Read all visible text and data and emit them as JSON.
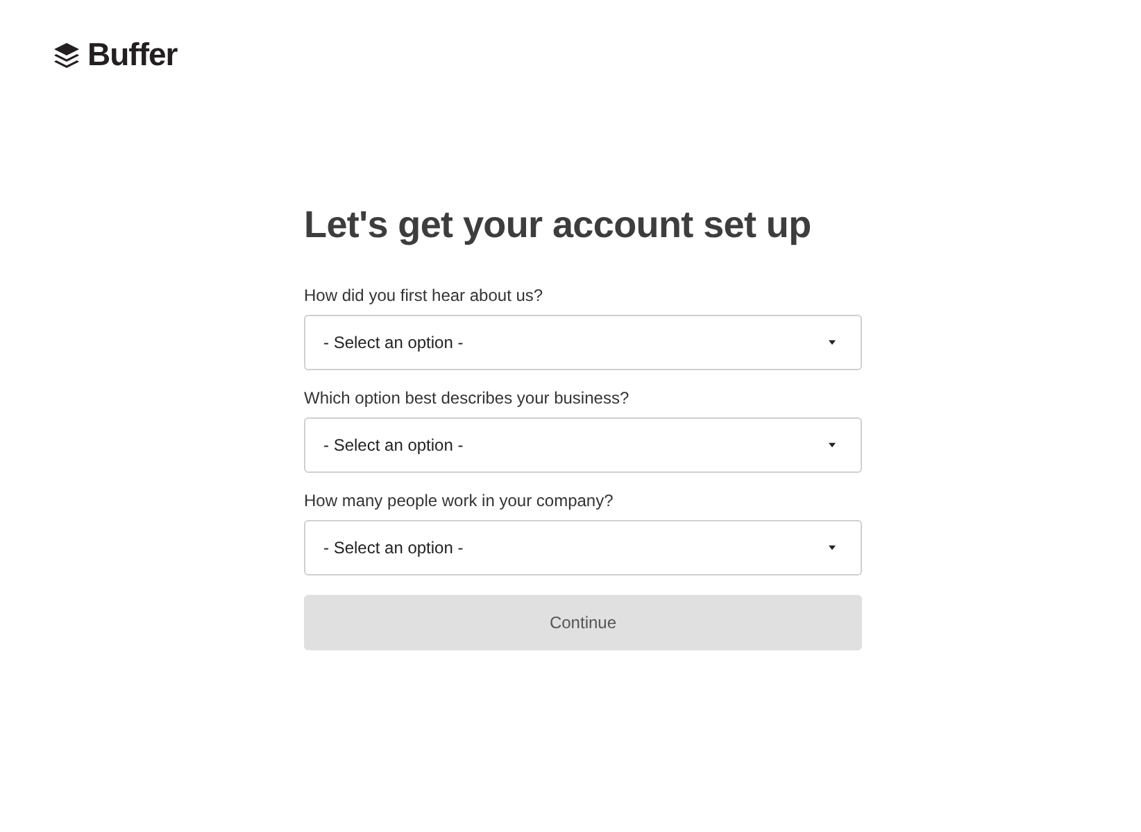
{
  "logo": {
    "text": "Buffer"
  },
  "title": "Let's get your account set up",
  "questions": [
    {
      "label": "How did you first hear about us?",
      "value": "- Select an option -"
    },
    {
      "label": "Which option best describes your business?",
      "value": "- Select an option -"
    },
    {
      "label": "How many people work in your company?",
      "value": "- Select an option -"
    }
  ],
  "continue_button": {
    "label": "Continue",
    "disabled": true
  }
}
